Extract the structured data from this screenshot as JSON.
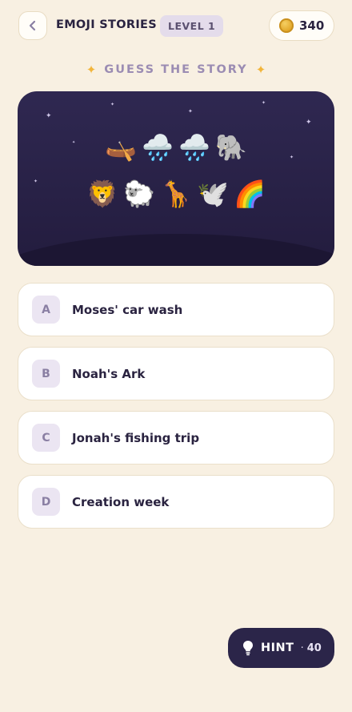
{
  "header": {
    "title": "EMOJI STORIES",
    "level": "LEVEL 1",
    "coins": "340"
  },
  "prompt": {
    "text": "GUESS THE STORY"
  },
  "puzzle": {
    "row1": [
      "🛶",
      "🌧️",
      "🌧️",
      "🐘"
    ],
    "row2": [
      "🦁",
      "🐑",
      "🦒",
      "🕊️",
      "🌈"
    ]
  },
  "answers": [
    {
      "letter": "A",
      "text": "Moses' car wash"
    },
    {
      "letter": "B",
      "text": "Noah's Ark"
    },
    {
      "letter": "C",
      "text": "Jonah's fishing trip"
    },
    {
      "letter": "D",
      "text": "Creation week"
    }
  ],
  "hint": {
    "label": "HINT",
    "dot": "·",
    "cost": "40"
  },
  "colors": {
    "background": "#f8f0e2",
    "card": "#2f2851",
    "accent": "#9b8cb3",
    "coin": "#e3a82a"
  }
}
